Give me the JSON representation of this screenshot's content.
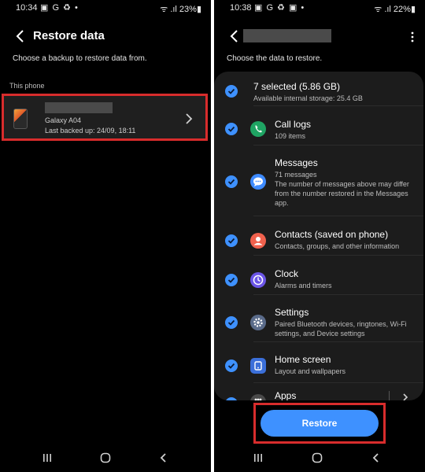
{
  "left": {
    "status": {
      "time": "10:34",
      "notifications": "▣ G ♻ •",
      "system": "ᯤ .ıl 23%▮"
    },
    "title": "Restore data",
    "subtitle": "Choose a backup to restore data from.",
    "section": "This phone",
    "device": {
      "model": "Galaxy A04",
      "last_backup": "Last backed up: 24/09, 18:11"
    }
  },
  "right": {
    "status": {
      "time": "10:38",
      "notifications": "▣ G ♻ ▣ •",
      "system": "ᯤ .ıl 22%▮"
    },
    "subtitle": "Choose the data to restore.",
    "summary": {
      "title": "7 selected (5.86 GB)",
      "storage": "Available internal storage: 25.4 GB"
    },
    "items": [
      {
        "title": "Call logs",
        "sub": "109 items",
        "icon": "phone-icon",
        "color": "#1fa463"
      },
      {
        "title": "Messages",
        "sub": "71 messages\nThe number of messages above may differ from the number restored in the Messages app.",
        "icon": "message-icon",
        "color": "#3e8bff"
      },
      {
        "title": "Contacts (saved on phone)",
        "sub": "Contacts, groups, and other information",
        "icon": "person-icon",
        "color": "#f0614d"
      },
      {
        "title": "Clock",
        "sub": "Alarms and timers",
        "icon": "clock-icon",
        "color": "#6b55e6"
      },
      {
        "title": "Settings",
        "sub": "Paired Bluetooth devices, ringtones, Wi-Fi settings, and Device settings",
        "icon": "gear-icon",
        "color": "#5a6b8a"
      },
      {
        "title": "Home screen",
        "sub": "Layout and wallpapers",
        "icon": "home-icon",
        "color": "#3b6fd9"
      },
      {
        "title": "Apps",
        "sub": "",
        "icon": "apps-icon",
        "color": "#4a4a4a"
      }
    ],
    "restore_label": "Restore"
  },
  "colors": {
    "accent": "#3e91ff",
    "highlight": "#d82c2c",
    "card": "#1c1c1c"
  }
}
